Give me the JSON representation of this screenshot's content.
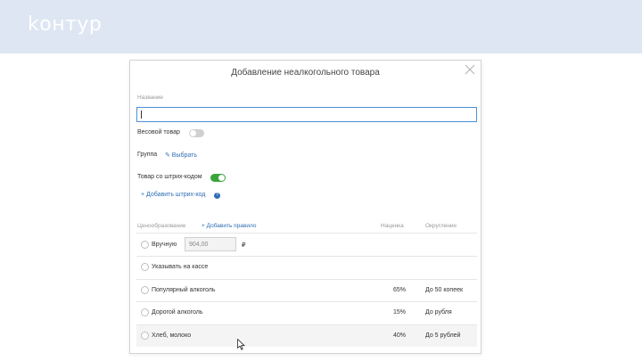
{
  "app": {
    "logo_text": "kонтур"
  },
  "modal": {
    "title": "Добавление неалкогольного товара",
    "name_label": "Название",
    "name_value": "",
    "weighted_label": "Весовой товар",
    "weighted_on": false,
    "group_label": "Группа",
    "group_link": "✎ Выбрать",
    "barcode_label": "Товар со штрих-кодом",
    "barcode_on": true,
    "add_barcode_link": "+ Добавить штрих-код",
    "help_glyph": "?"
  },
  "pricing": {
    "section_label": "Ценообразование",
    "add_rule_link": "+ Добавить правило",
    "col_markup": "Наценка",
    "col_rounding": "Округление",
    "rows": [
      {
        "label": "Вручную",
        "input_value": "904,00",
        "currency": "₽",
        "markup": "",
        "rounding": ""
      },
      {
        "label": "Указывать на кассе",
        "markup": "",
        "rounding": ""
      },
      {
        "label": "Популярный алкоголь",
        "markup": "65%",
        "rounding": "До 50 копеек"
      },
      {
        "label": "Дорогой алкоголь",
        "markup": "15%",
        "rounding": "До рубля"
      },
      {
        "label": "Хлеб, молоко",
        "markup": "40%",
        "rounding": "До 5 рублей"
      }
    ]
  },
  "icons": {
    "close": "close-icon",
    "cursor": "mouse-pointer-icon"
  }
}
